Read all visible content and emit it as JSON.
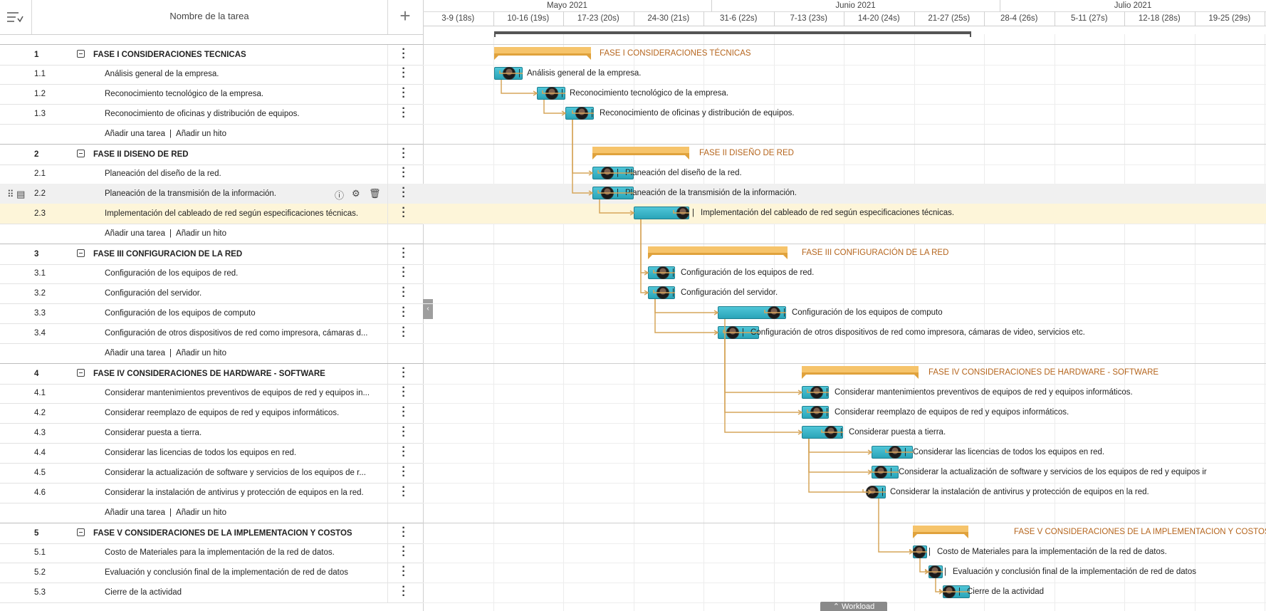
{
  "header": {
    "task_name_col": "Nombre de la tarea",
    "add_icon": "plus-icon",
    "menu_icon": "list-menu-icon"
  },
  "timeline": {
    "months": [
      "Mayo 2021",
      "Junio 2021",
      "Julio 2021"
    ],
    "weeks": [
      "3-9 (18s)",
      "10-16 (19s)",
      "17-23 (20s)",
      "24-30 (21s)",
      "31-6 (22s)",
      "7-13 (23s)",
      "14-20 (24s)",
      "21-27 (25s)",
      "28-4 (26s)",
      "5-11 (27s)",
      "12-18 (28s)",
      "19-25 (29s)"
    ]
  },
  "add_links": {
    "task": "Añadir una tarea",
    "separator": "|",
    "milestone": "Añadir un hito"
  },
  "rows": [
    {
      "kind": "phase",
      "num": "1",
      "name": "FASE I CONSIDERACIONES TÉCNICAS",
      "label": "FASE I CONSIDERACIONES TÉCNICAS"
    },
    {
      "kind": "task",
      "num": "1.1",
      "name": "Análisis general de la empresa.",
      "label": "Análisis general de la empresa."
    },
    {
      "kind": "task",
      "num": "1.2",
      "name": "Reconocimiento tecnológico de la empresa.",
      "label": "Reconocimiento tecnológico de la empresa."
    },
    {
      "kind": "task",
      "num": "1.3",
      "name": "Reconocimiento de oficinas y distribución de equipos.",
      "label": "Reconocimiento de oficinas y distribución de equipos."
    },
    {
      "kind": "add"
    },
    {
      "kind": "phase",
      "num": "2",
      "name": "FASE II DISEÑO DE RED",
      "label": "FASE II DISEÑO DE RED"
    },
    {
      "kind": "task",
      "num": "2.1",
      "name": "Planeación del diseño de la red.",
      "label": "Planeación del diseño de la red."
    },
    {
      "kind": "task",
      "num": "2.2",
      "name": "Planeación de la transmisión de la información.",
      "label": "Planeación de la transmisión de la información.",
      "state": "selected"
    },
    {
      "kind": "task",
      "num": "2.3",
      "name": "Implementación del cableado de red según especificaciones técnicas.",
      "label": "Implementación del cableado de red según especificaciones técnicas.",
      "state": "highlight"
    },
    {
      "kind": "add"
    },
    {
      "kind": "phase",
      "num": "3",
      "name": "FASE III CONFIGURACIÓN DE LA RED",
      "label": "FASE III CONFIGURACIÓN DE LA RED"
    },
    {
      "kind": "task",
      "num": "3.1",
      "name": "Configuración de los equipos de red.",
      "label": "Configuración de los equipos de red."
    },
    {
      "kind": "task",
      "num": "3.2",
      "name": "Configuración del servidor.",
      "label": "Configuración del servidor."
    },
    {
      "kind": "task",
      "num": "3.3",
      "name": "Configuración de los equipos de computo",
      "label": "Configuración de los equipos de computo"
    },
    {
      "kind": "task",
      "num": "3.4",
      "name": "Configuración de otros dispositivos de red como impresora, cámaras d...",
      "label": "Configuración de otros dispositivos de red como impresora, cámaras de video, servicios etc."
    },
    {
      "kind": "add"
    },
    {
      "kind": "phase",
      "num": "4",
      "name": "FASE IV CONSIDERACIONES DE HARDWARE - SOFTWARE",
      "label": "FASE IV CONSIDERACIONES DE HARDWARE - SOFTWARE"
    },
    {
      "kind": "task",
      "num": "4.1",
      "name": "Considerar mantenimientos preventivos de equipos de red y equipos in...",
      "label": "Considerar mantenimientos preventivos de equipos de red y equipos informáticos."
    },
    {
      "kind": "task",
      "num": "4.2",
      "name": "Considerar reemplazo de equipos de red y equipos informáticos.",
      "label": "Considerar reemplazo de equipos de red y equipos informáticos."
    },
    {
      "kind": "task",
      "num": "4.3",
      "name": "Considerar puesta a tierra.",
      "label": "Considerar puesta a tierra."
    },
    {
      "kind": "task",
      "num": "4.4",
      "name": "Considerar las licencias de todos los equipos en red.",
      "label": "Considerar las licencias de todos los equipos en red."
    },
    {
      "kind": "task",
      "num": "4.5",
      "name": "Considerar la actualización de software y servicios de los equipos de r...",
      "label": "Considerar la actualización de software y servicios de los equipos de red y equipos ir"
    },
    {
      "kind": "task",
      "num": "4.6",
      "name": "Considerar la instalación de antivirus y protección de equipos en la red.",
      "label": "Considerar la instalación de antivirus y protección de equipos en la red."
    },
    {
      "kind": "add"
    },
    {
      "kind": "phase",
      "num": "5",
      "name": "FASE V CONSIDERACIONES DE LA IMPLEMENTACION Y COSTOS",
      "label": "FASE V CONSIDERACIONES DE LA IMPLEMENTACION Y COSTOS"
    },
    {
      "kind": "task",
      "num": "5.1",
      "name": "Costo de Materiales para la implementación de la red de datos.",
      "label": "Costo de Materiales para la implementación de la red de datos."
    },
    {
      "kind": "task",
      "num": "5.2",
      "name": "Evaluación y conclusión final de la implementación de red de datos",
      "label": "Evaluación y conclusión final de la implementación de red de datos"
    },
    {
      "kind": "task",
      "num": "5.3",
      "name": "Cierre de la actividad",
      "label": "Cierre de la actividad"
    }
  ],
  "row_icons": [
    "info-icon",
    "gear-icon",
    "trash-icon"
  ],
  "panel_toggle": "‹",
  "workload_label": "⌃ Workload",
  "label_separator": "|",
  "colors": {
    "task_bar": "#2aa4b8",
    "phase_bar": "#f6c46b",
    "phase_text": "#b5651d",
    "link": "#d6a55a",
    "highlight": "#fdf5d9"
  }
}
